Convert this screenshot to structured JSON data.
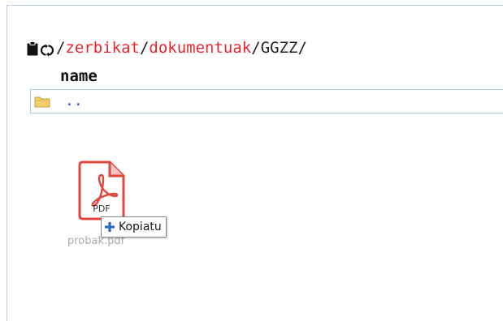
{
  "breadcrumb": {
    "links": [
      "zerbikat",
      "dokumentuak"
    ],
    "current": "GGZZ",
    "separator": "/"
  },
  "table": {
    "column_header": "name",
    "parent_label": ".."
  },
  "drag": {
    "file_type_label": "PDF",
    "file_name": "probak.pdf",
    "action_label": "Kopiatu"
  },
  "icons": {
    "clipboard": "clipboard-icon",
    "refresh": "refresh-icon",
    "folder": "folder-icon",
    "pdf": "pdf-file-icon",
    "plus": "plus-icon"
  },
  "colors": {
    "link_red": "#e8262c",
    "parent_link_blue": "#2b4cc8",
    "border_blue": "#a9c8e8",
    "pdf_red": "#e0463c",
    "folder_yellow": "#f2cf6e",
    "plus_blue": "#2a62c9"
  }
}
